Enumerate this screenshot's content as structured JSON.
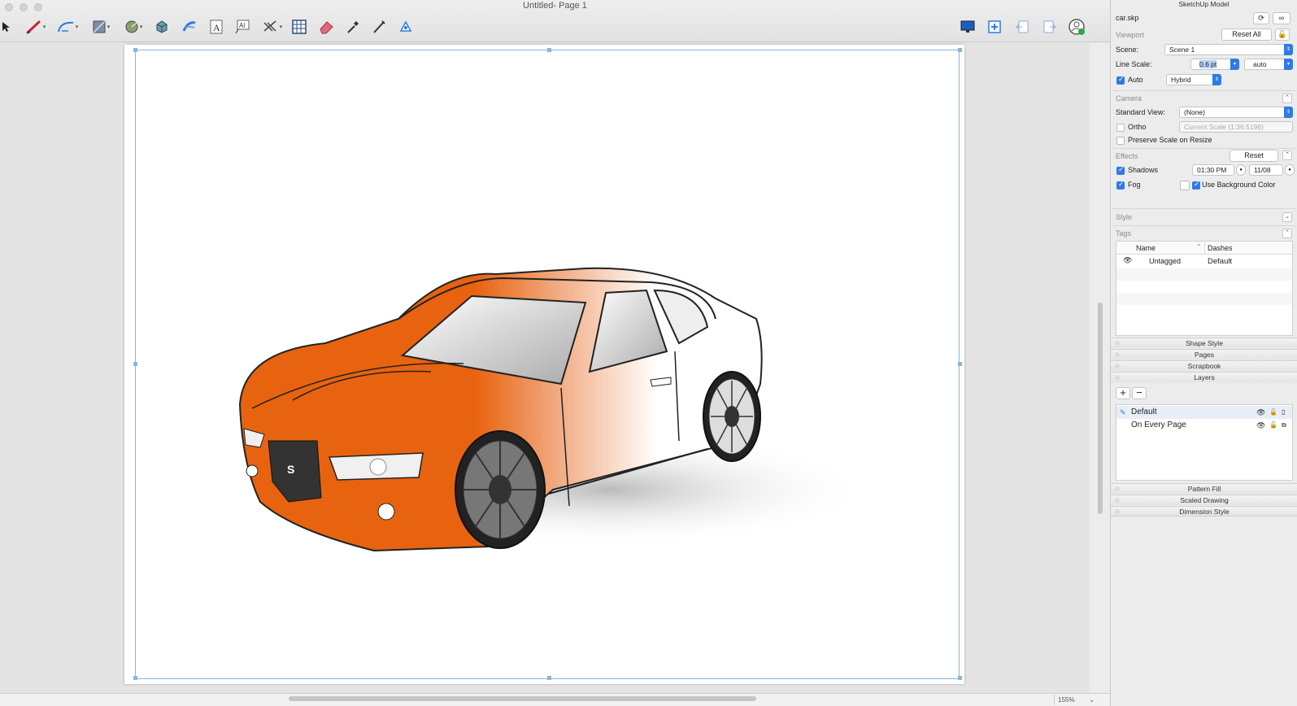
{
  "window": {
    "title": "Untitled- Page 1"
  },
  "toolbar": {
    "tools": [
      "select-tool",
      "line-tool",
      "arc-tool",
      "shape-tool",
      "circle-tool",
      "model-tool",
      "style-tool",
      "text-tool",
      "label-tool",
      "dimension-tool",
      "table-tool",
      "eraser-tool",
      "eyedropper-tool",
      "split-tool",
      "join-tool"
    ],
    "right_tools": [
      "presentation-icon",
      "add-page-icon",
      "previous-page-icon",
      "next-page-icon",
      "account-icon"
    ]
  },
  "status": {
    "zoom": "155%"
  },
  "panel": {
    "title": "SketchUp Model",
    "file_name": "car.skp",
    "viewport": {
      "section": "Viewport",
      "reset_all": "Reset All",
      "scene_label": "Scene:",
      "scene_value": "Scene 1",
      "line_scale_label": "Line Scale:",
      "line_scale_value": "0.6 pt",
      "line_scale_auto": "auto",
      "auto_label": "Auto",
      "render_mode": "Hybrid"
    },
    "camera": {
      "section": "Camera",
      "standard_view_label": "Standard View:",
      "standard_view_value": "(None)",
      "ortho_label": "Ortho",
      "ortho_scale": "Current Scale (1:36.5196)",
      "preserve_label": "Preserve Scale on Resize"
    },
    "effects": {
      "section": "Effects",
      "reset": "Reset",
      "shadows_label": "Shadows",
      "shadow_time": "01:30 PM",
      "shadow_date": "11/08",
      "fog_label": "Fog",
      "use_bg_label": "Use Background Color"
    },
    "style": {
      "section": "Style"
    },
    "tags": {
      "section": "Tags",
      "col_name": "Name",
      "col_dashes": "Dashes",
      "rows": [
        {
          "name": "Untagged",
          "dashes": "Default"
        }
      ]
    },
    "trays": {
      "shape_style": "Shape Style",
      "pages": "Pages",
      "scrapbook": "Scrapbook",
      "layers": "Layers",
      "pattern_fill": "Pattern Fill",
      "scaled_drawing": "Scaled Drawing",
      "dimension_style": "Dimension Style"
    },
    "layers": {
      "add": "+",
      "remove": "−",
      "items": [
        "Default",
        "On Every Page"
      ]
    }
  },
  "colors": {
    "accent": "#2f7be3",
    "car_orange": "#e8630f",
    "selection": "#8ab4e0"
  }
}
